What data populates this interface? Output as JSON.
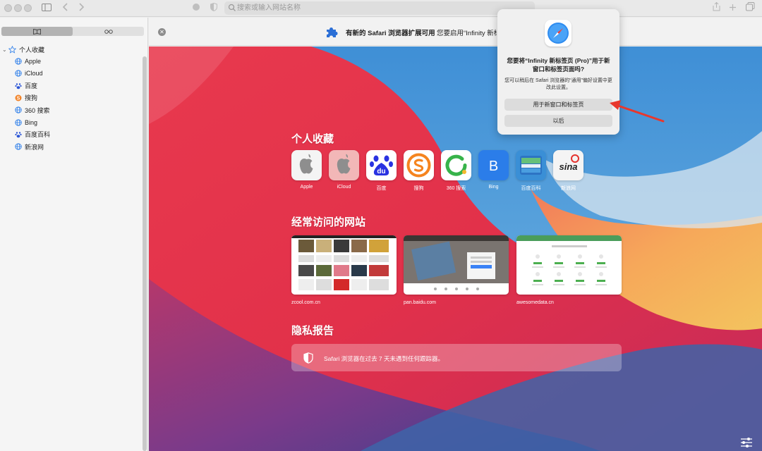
{
  "toolbar": {
    "address_placeholder": "搜索或输入网站名称"
  },
  "sidebar": {
    "section_title": "个人收藏",
    "items": [
      {
        "label": "Apple",
        "icon": "globe-icon"
      },
      {
        "label": "iCloud",
        "icon": "globe-icon"
      },
      {
        "label": "百度",
        "icon": "baidu-paw-icon"
      },
      {
        "label": "搜狗",
        "icon": "sogou-icon"
      },
      {
        "label": "360 搜索",
        "icon": "globe-icon"
      },
      {
        "label": "Bing",
        "icon": "globe-icon"
      },
      {
        "label": "百度百科",
        "icon": "baidu-paw-icon"
      },
      {
        "label": "新浪网",
        "icon": "globe-icon"
      }
    ]
  },
  "banner": {
    "message_bold": "有新的 Safari 浏览器扩展可用",
    "message": "您要启用“Infinity 新标签页”吗？"
  },
  "main": {
    "favorites_title": "个人收藏",
    "favorites": [
      {
        "label": "Apple",
        "bg": "#f4f4f4"
      },
      {
        "label": "iCloud",
        "bg": "#f2b7b7"
      },
      {
        "label": "百度",
        "bg": "#ffffff"
      },
      {
        "label": "搜狗",
        "bg": "#ffffff"
      },
      {
        "label": "360 搜索",
        "bg": "#ffffff"
      },
      {
        "label": "Bing",
        "bg": "#2b7de9"
      },
      {
        "label": "百度百科",
        "bg": "#3a8fd6"
      },
      {
        "label": "新浪网",
        "bg": "#f4f4f4"
      }
    ],
    "bing_letter": "B",
    "sina_text": "sina",
    "baidu_text": "du",
    "frequent_title": "经常访问的网站",
    "frequent": [
      {
        "label": "zcool.com.cn"
      },
      {
        "label": "pan.baidu.com"
      },
      {
        "label": "awesomedata.cn"
      }
    ],
    "privacy_title": "隐私报告",
    "privacy_text": "Safari 浏览器在过去 7 天未遇到任何跟踪器。"
  },
  "popover": {
    "title": "您要将“Infinity 新标签页 (Pro)”用于新窗口和标签页面吗?",
    "body": "您可以稍后在 Safari 浏览器的“通用”偏好设置中更改此设置。",
    "primary_button": "用于新窗口和标签页",
    "secondary_button": "以后"
  },
  "colors": {
    "arrow": "#e8372c",
    "accent_blue": "#2b7de9"
  }
}
